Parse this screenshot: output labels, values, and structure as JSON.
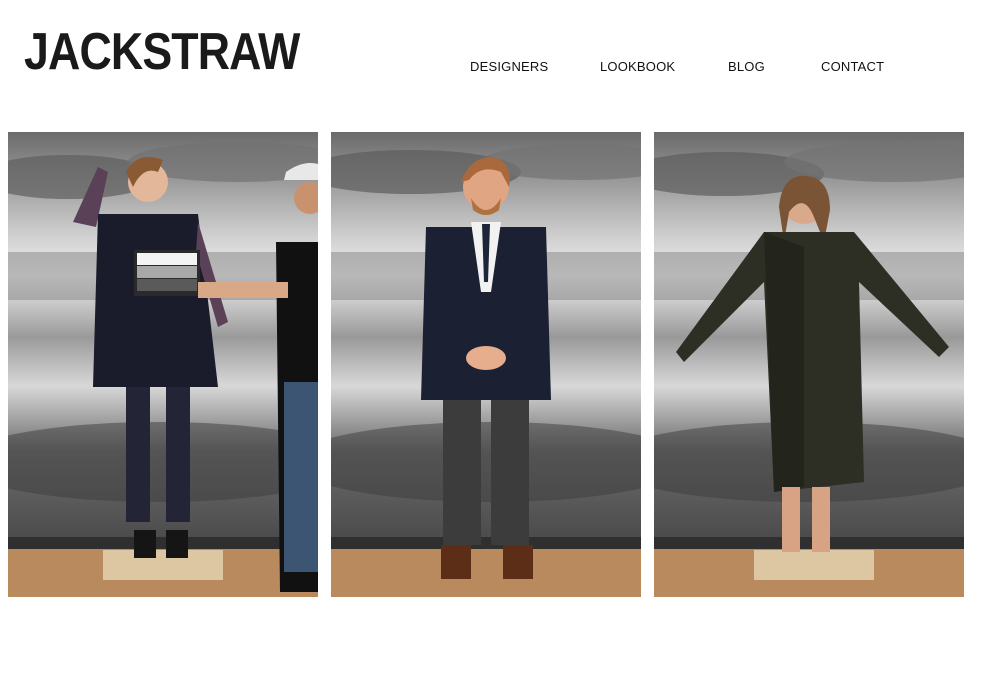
{
  "brand": {
    "logo_text": "JACKSTRAW"
  },
  "nav": {
    "items": [
      {
        "label": "DESIGNERS"
      },
      {
        "label": "LOOKBOOK"
      },
      {
        "label": "BLOG"
      },
      {
        "label": "CONTACT"
      }
    ]
  },
  "gallery": {
    "photos": [
      {
        "subject": "woman in navy pinafore holding grey color card, assistant in cap beside her"
      },
      {
        "subject": "man in navy jacket, dotted tie, grey trousers and brown boots"
      },
      {
        "subject": "woman in long dark pleated coat with arms spread, barefoot"
      }
    ]
  },
  "colors": {
    "background": "#ffffff",
    "text": "#111111",
    "floor": "#b98a5e"
  }
}
